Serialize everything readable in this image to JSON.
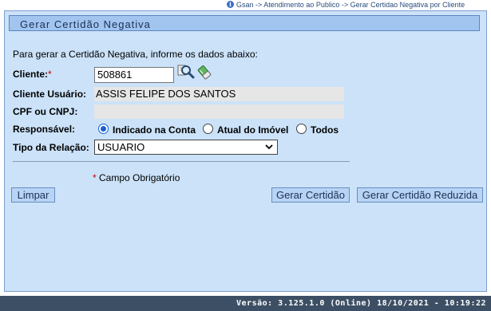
{
  "breadcrumb": {
    "text": "Gsan -> Atendimento ao Publico -> Gerar Certidao Negativa por Cliente"
  },
  "form": {
    "title": "Gerar Certidão Negativa",
    "intro": "Para gerar a Certidão Negativa, informe os dados abaixo:",
    "cliente": {
      "label": "Cliente:",
      "required_mark": "*",
      "value": "508861"
    },
    "cliente_usuario": {
      "label": "Cliente Usuário:",
      "value": "ASSIS FELIPE DOS SANTOS"
    },
    "cpf_cnpj": {
      "label": "CPF ou CNPJ:",
      "value": ""
    },
    "responsavel": {
      "label": "Responsável:",
      "options": [
        "Indicado na Conta",
        "Atual do Imóvel",
        "Todos"
      ],
      "selected": "Indicado na Conta"
    },
    "tipo_relacao": {
      "label": "Tipo da Relação:",
      "value": "USUARIO"
    },
    "mandatory_note": {
      "mark": "*",
      "text": "Campo Obrigatório"
    }
  },
  "buttons": {
    "limpar": "Limpar",
    "gerar": "Gerar Certidão",
    "gerar_reduzida": "Gerar Certidão Reduzida"
  },
  "icons": {
    "search": "magnifier-search-icon",
    "clear": "eraser-icon",
    "info": "info-icon"
  },
  "colors": {
    "panel_bg": "#cbe2f9",
    "header_bg": "#a2c5ef",
    "button_bg": "#b8d4f5",
    "footer_bg": "#3d4f64",
    "required": "#cc0000",
    "radio_checked": "#1a5fd6"
  },
  "footer": {
    "version": "Versão: 3.125.1.0 (Online) 18/10/2021 - 10:19:22"
  }
}
